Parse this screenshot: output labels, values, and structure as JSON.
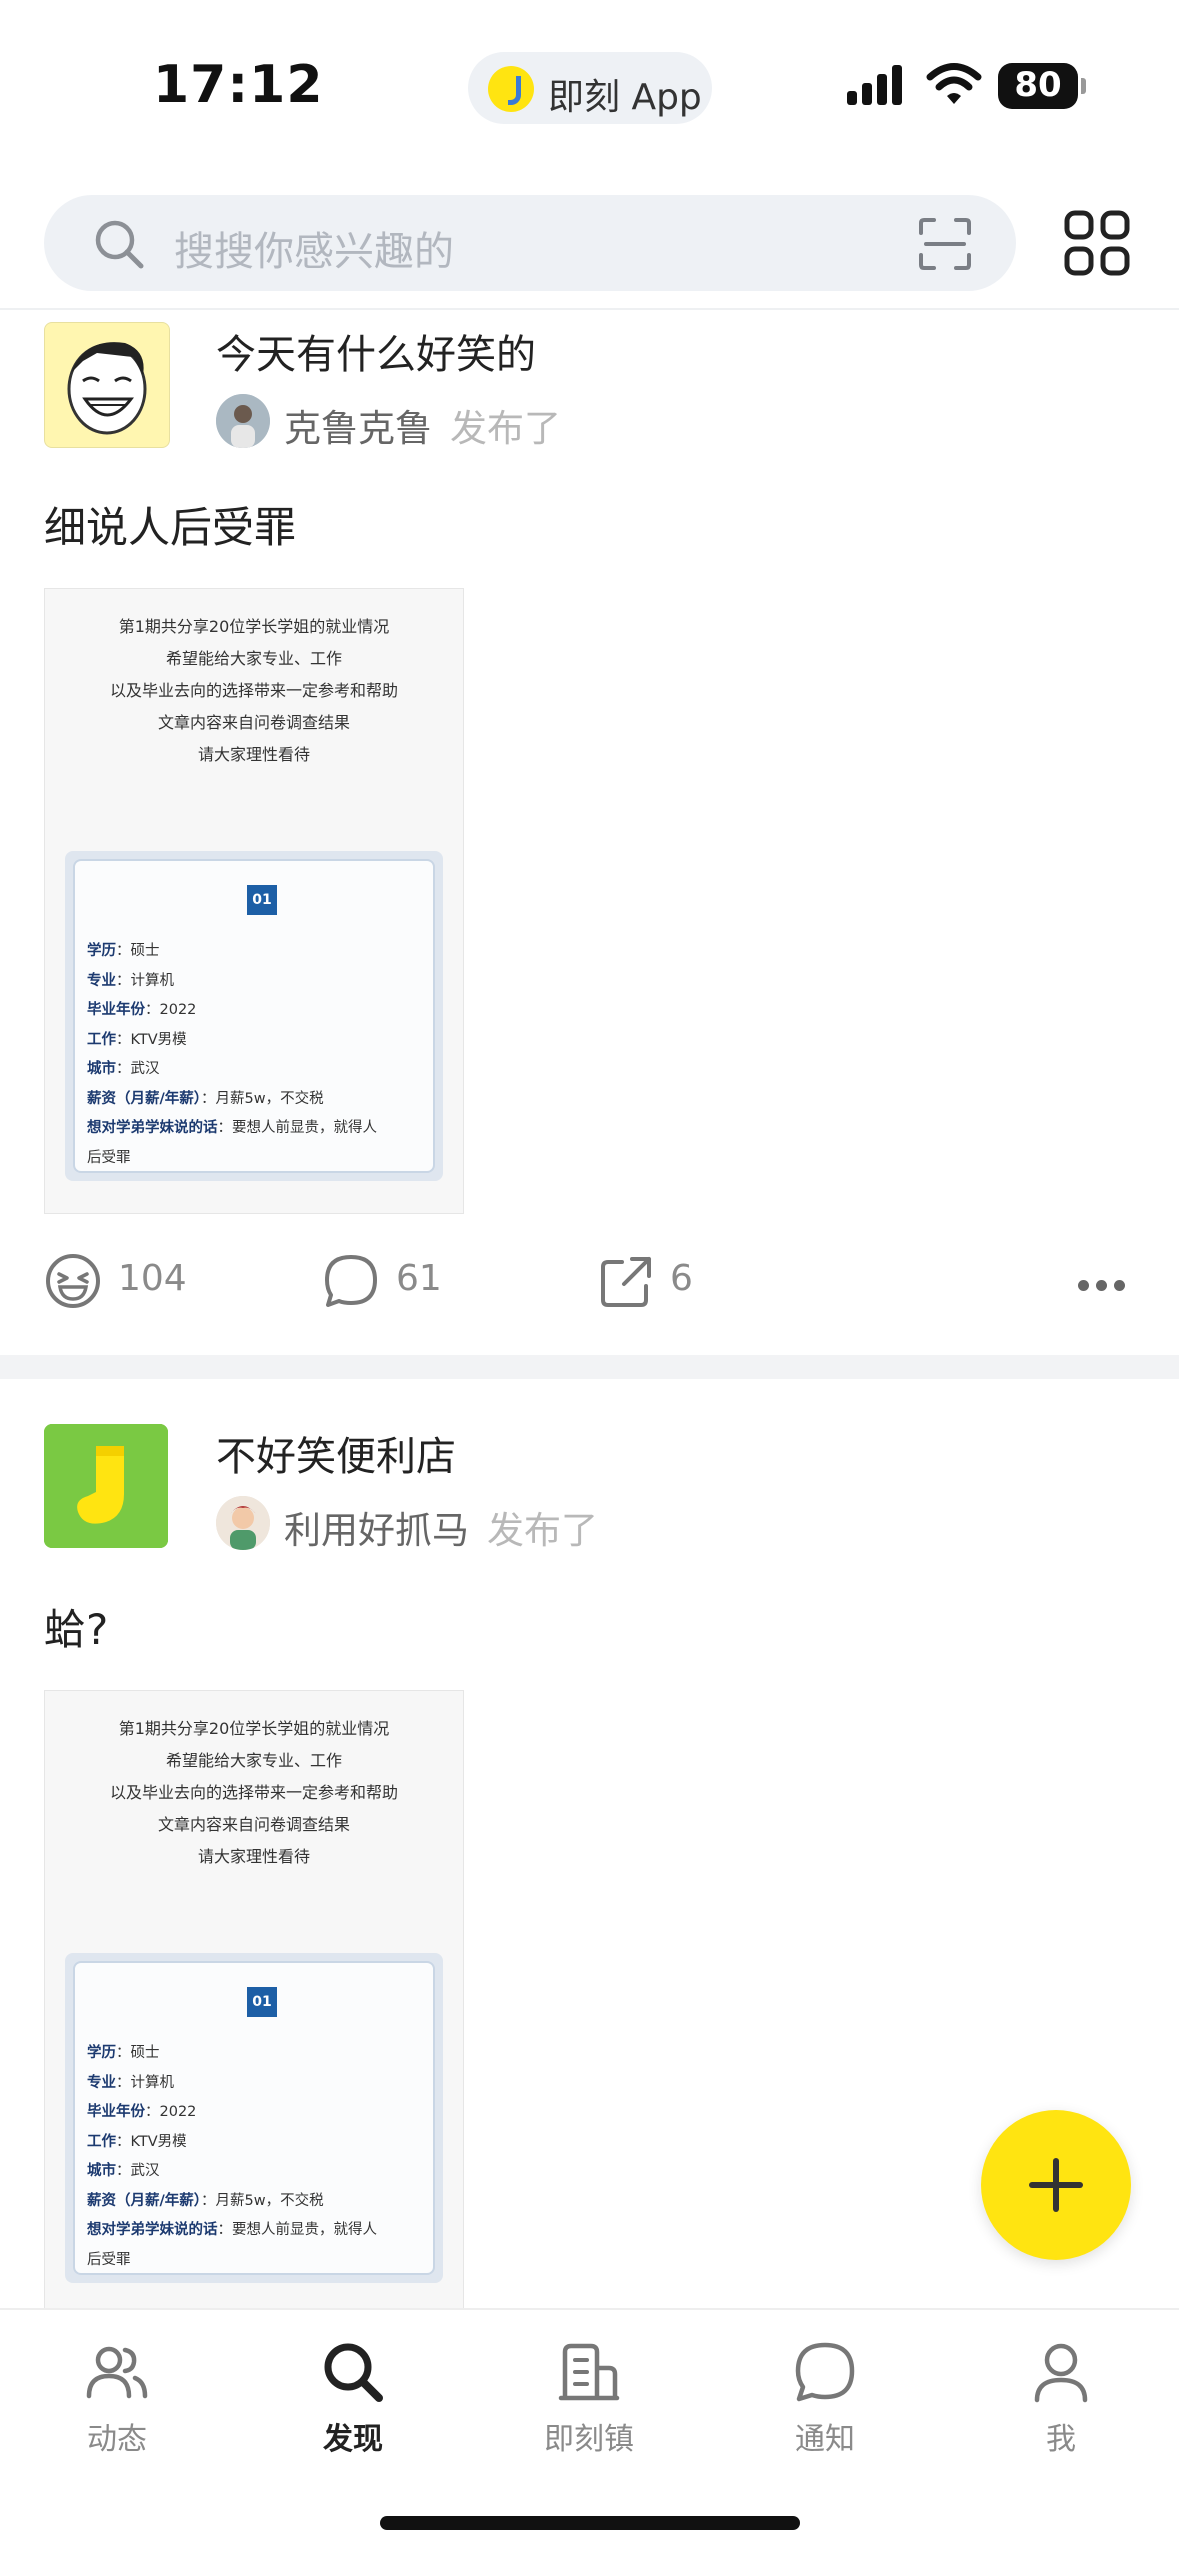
{
  "status_bar": {
    "time": "17:12",
    "app_pill_label": "即刻 App",
    "battery": "80"
  },
  "search": {
    "placeholder": "搜搜你感兴趣的"
  },
  "posts": [
    {
      "topic": "今天有什么好笑的",
      "user": "克鲁克鲁",
      "action_text": "发布了",
      "text": "细说人后受罪",
      "likes": "104",
      "comments": "61",
      "shares": "6"
    },
    {
      "topic": "不好笑便利店",
      "user": "利用好抓马",
      "action_text": "发布了",
      "text": "蛤?"
    }
  ],
  "post_image": {
    "header_lines": [
      "第1期共分享20位学长学姐的就业情况",
      "希望能给大家专业、工作",
      "以及毕业去向的选择带来一定参考和帮助",
      "文章内容来自问卷调查结果",
      "请大家理性看待"
    ],
    "badge": "01",
    "rows": [
      {
        "label": "学历",
        "value": "：硕士"
      },
      {
        "label": "专业",
        "value": "：计算机"
      },
      {
        "label": "毕业年份",
        "value": "：2022"
      },
      {
        "label": "工作",
        "value": "：KTV男模"
      },
      {
        "label": "城市",
        "value": "：武汉"
      },
      {
        "label": "薪资（月薪/年薪）",
        "value": "：月薪5w，不交税"
      },
      {
        "label": "想对学弟学妹说的话",
        "value": "：要想人前显贵，就得人"
      },
      {
        "label": "",
        "value": "后受罪"
      }
    ]
  },
  "tabs": [
    {
      "label": "动态",
      "icon": "users-icon"
    },
    {
      "label": "发现",
      "icon": "search-icon"
    },
    {
      "label": "即刻镇",
      "icon": "building-icon"
    },
    {
      "label": "通知",
      "icon": "chat-bubble-icon"
    },
    {
      "label": "我",
      "icon": "person-icon"
    }
  ],
  "colors": {
    "accent": "#ffe411",
    "search_bg": "#eef1f5"
  }
}
